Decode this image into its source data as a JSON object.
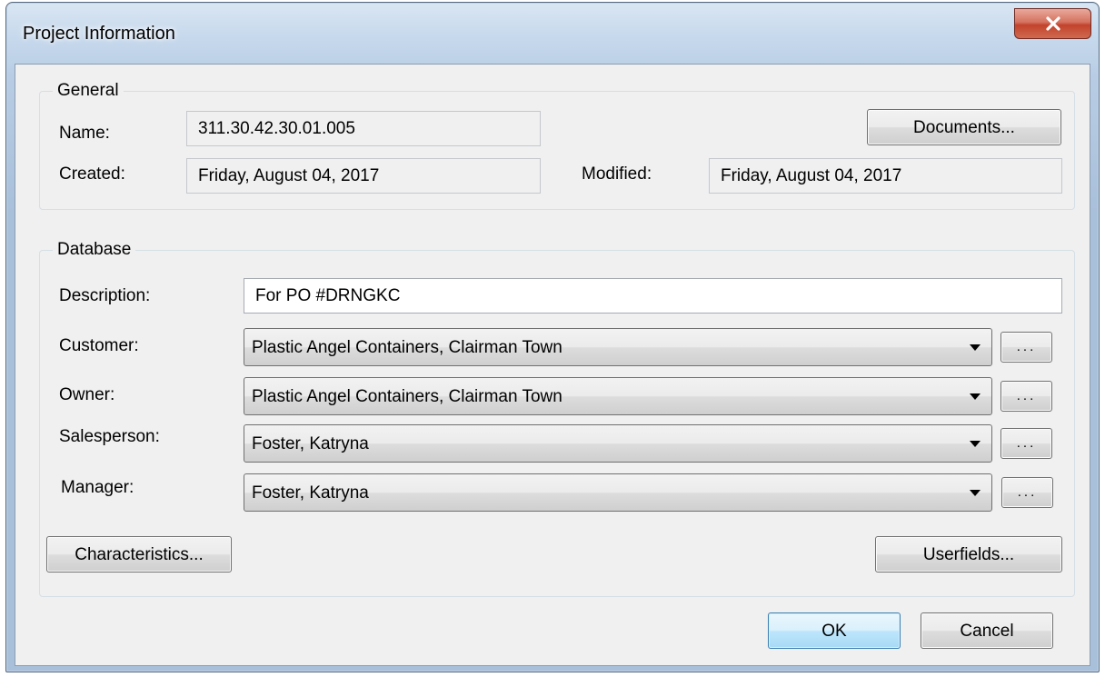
{
  "window": {
    "title": "Project Information",
    "close_icon": "close-icon"
  },
  "general": {
    "legend": "General",
    "name_label": "Name:",
    "name_value": "311.30.42.30.01.005",
    "created_label": "Created:",
    "created_value": "Friday, August 04, 2017",
    "modified_label": "Modified:",
    "modified_value": "Friday, August 04, 2017",
    "documents_button": "Documents..."
  },
  "database": {
    "legend": "Database",
    "description_label": "Description:",
    "description_value": "For PO #DRNGKC",
    "customer_label": "Customer:",
    "customer_value": "Plastic Angel Containers, Clairman Town",
    "owner_label": "Owner:",
    "owner_value": "Plastic Angel Containers, Clairman Town",
    "salesperson_label": "Salesperson:",
    "salesperson_value": "Foster, Katryna",
    "manager_label": "Manager:",
    "manager_value": "Foster, Katryna",
    "ellipsis_label": "...",
    "characteristics_button": "Characteristics...",
    "userfields_button": "Userfields..."
  },
  "footer": {
    "ok_button": "OK",
    "cancel_button": "Cancel"
  },
  "colors": {
    "close_button": "#c2432c",
    "default_button_border": "#3c7fb1",
    "dialog_background": "#f0f0f0",
    "frame": "#a9c0db"
  }
}
